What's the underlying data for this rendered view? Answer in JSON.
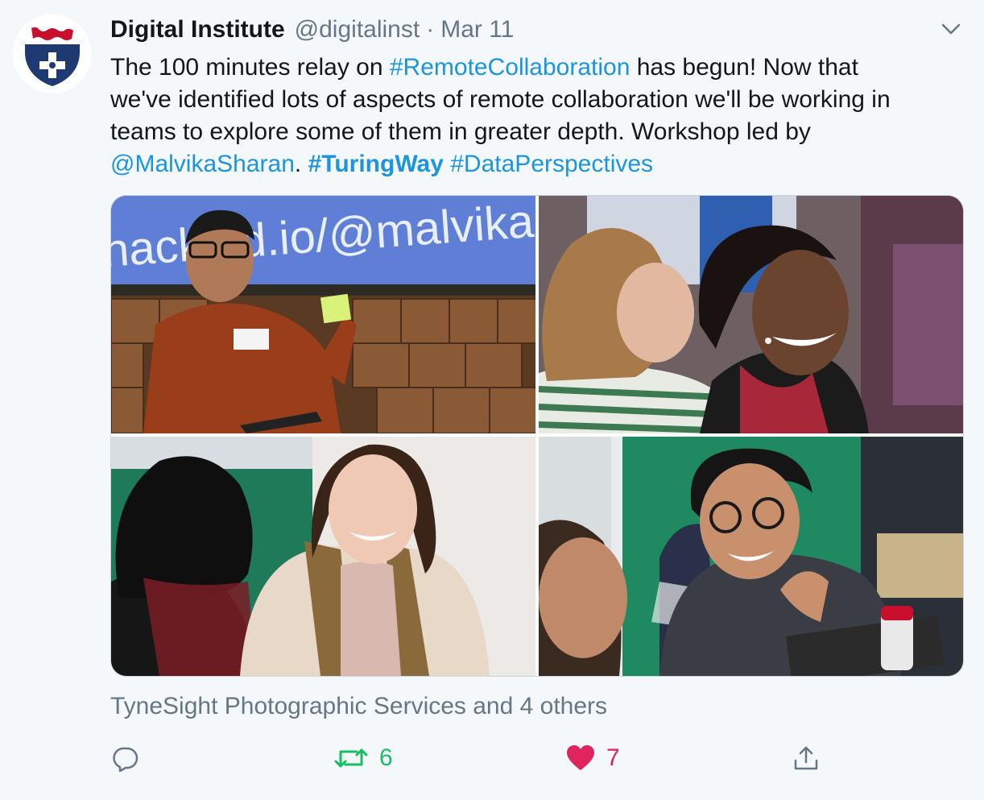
{
  "tweet": {
    "author_name": "Digital Institute",
    "author_handle": "@digitalinst",
    "separator": "·",
    "date": "Mar 11",
    "text_lines": {
      "l1_a": "The 100 minutes relay on ",
      "l1_link": "#RemoteCollaboration",
      "l1_b": " has begun! Now that",
      "l2": "we've identified lots of aspects of remote collaboration we'll be working in",
      "l3": "teams to explore some of them in greater depth.  Workshop led by",
      "l4_mention": "@MalvikaSharan",
      "l4_dot": ". ",
      "l4_tag1": "#TuringWay",
      "l4_space": " ",
      "l4_tag2": "#DataPerspectives"
    },
    "photo_banner_text": "hackmd.io/@malvikas",
    "social_context": "TyneSight Photographic Services and 4 others",
    "actions": {
      "reply_icon": "reply-icon",
      "retweet_icon": "retweet-icon",
      "retweet_count": "6",
      "like_icon": "heart-icon",
      "like_count": "7",
      "share_icon": "share-icon"
    }
  },
  "colors": {
    "link": "#1b95e0",
    "retweet_green": "#17bf63",
    "like_red": "#e0245e",
    "muted": "#657786",
    "text": "#14171a",
    "background": "#f5f8fa"
  }
}
